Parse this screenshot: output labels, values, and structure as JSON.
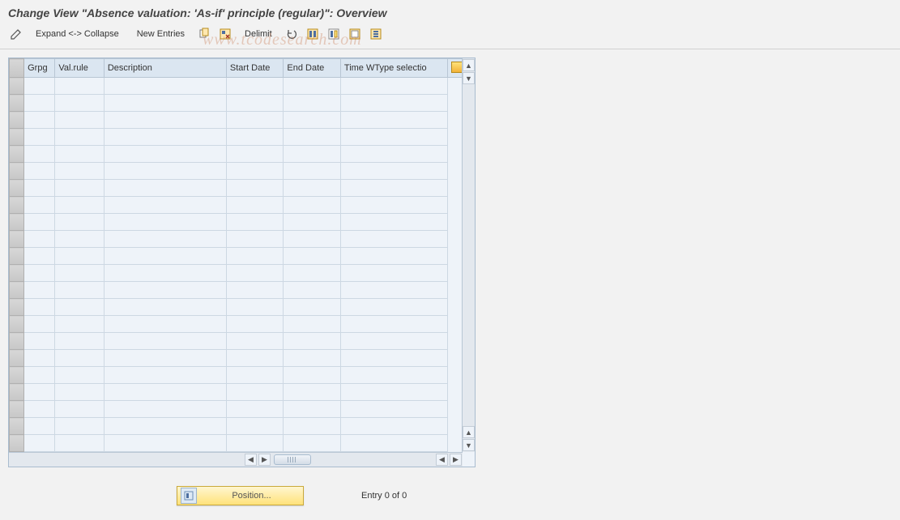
{
  "title": "Change View \"Absence valuation: 'As-if' principle (regular)\": Overview",
  "toolbar": {
    "expand_collapse_label": "Expand <-> Collapse",
    "new_entries_label": "New Entries",
    "delimit_label": "Delimit"
  },
  "watermark_text": "www.tcodesearch.com",
  "columns": {
    "grpg": "Grpg",
    "valrule": "Val.rule",
    "description": "Description",
    "start_date": "Start Date",
    "end_date": "End Date",
    "time_wtype": "Time WType selectio"
  },
  "row_count": 22,
  "footer": {
    "position_label": "Position...",
    "entry_text": "Entry 0 of 0"
  }
}
